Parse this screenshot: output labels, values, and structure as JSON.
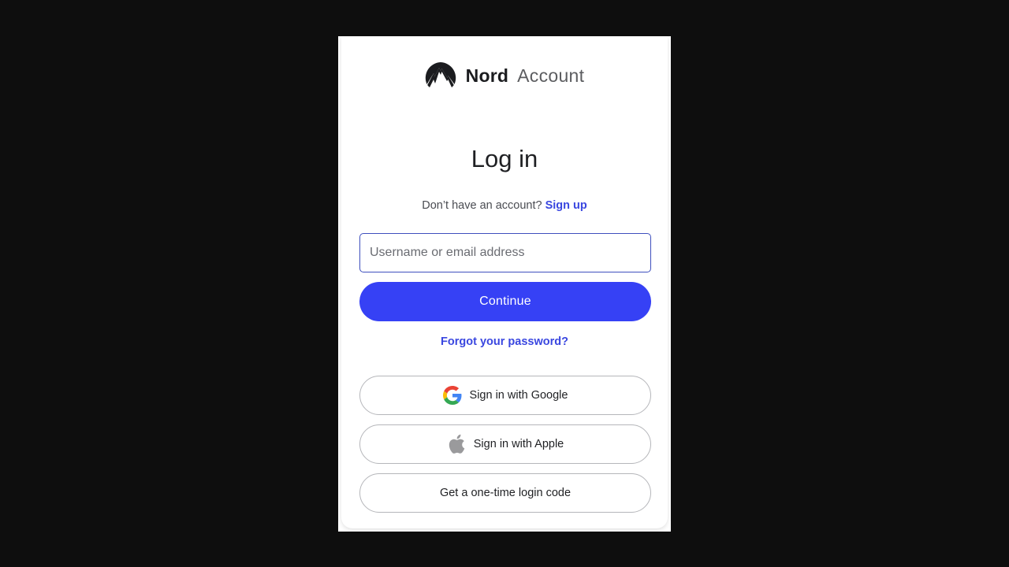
{
  "brand": {
    "name": "Nord",
    "product": "Account",
    "logo_icon": "nord-mountain-logo-icon"
  },
  "title": "Log in",
  "signup": {
    "prompt": "Don’t have an account?",
    "link_label": "Sign up"
  },
  "login_form": {
    "username_placeholder": "Username or email address",
    "username_value": "",
    "continue_label": "Continue",
    "forgot_label": "Forgot your password?"
  },
  "alt_signin": {
    "google_label": "Sign in with Google",
    "google_icon": "google-icon",
    "apple_label": "Sign in with Apple",
    "apple_icon": "apple-icon",
    "code_label": "Get a one-time login code"
  },
  "colors": {
    "accent": "#3641f5",
    "link": "#3a47e0",
    "input_border": "#3e4fbd",
    "background": "#0e0e0e"
  }
}
